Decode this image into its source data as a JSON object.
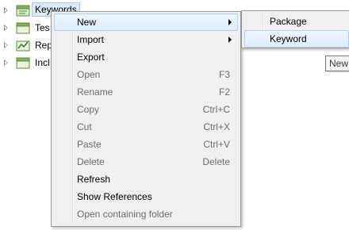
{
  "tree": {
    "items": [
      {
        "label": "Keywords",
        "icon": "keyword-folder-icon"
      },
      {
        "label": "Tes",
        "icon": "test-folder-icon"
      },
      {
        "label": "Rep",
        "icon": "report-folder-icon"
      },
      {
        "label": "Incl",
        "icon": "include-folder-icon"
      }
    ]
  },
  "context_menu": {
    "items": [
      {
        "label": "New",
        "shortcut": "",
        "enabled": true,
        "submenu": true
      },
      {
        "label": "Import",
        "shortcut": "",
        "enabled": true,
        "submenu": true
      },
      {
        "label": "Export",
        "shortcut": "",
        "enabled": true
      },
      {
        "label": "Open",
        "shortcut": "F3",
        "enabled": false
      },
      {
        "label": "Rename",
        "shortcut": "F2",
        "enabled": false
      },
      {
        "label": "Copy",
        "shortcut": "Ctrl+C",
        "enabled": false
      },
      {
        "label": "Cut",
        "shortcut": "Ctrl+X",
        "enabled": false
      },
      {
        "label": "Paste",
        "shortcut": "Ctrl+V",
        "enabled": false
      },
      {
        "label": "Delete",
        "shortcut": "Delete",
        "enabled": false
      },
      {
        "label": "Refresh",
        "shortcut": "",
        "enabled": true
      },
      {
        "label": "Show References",
        "shortcut": "",
        "enabled": true
      },
      {
        "label": "Open containing folder",
        "shortcut": "",
        "enabled": false
      }
    ]
  },
  "new_submenu": {
    "items": [
      {
        "label": "Package"
      },
      {
        "label": "Keyword"
      }
    ]
  },
  "tooltip": {
    "text": "New"
  },
  "colors": {
    "menu_bg": "#f0f0f0",
    "hover_border": "#aecff7",
    "disabled_text": "#6d6d6d"
  }
}
